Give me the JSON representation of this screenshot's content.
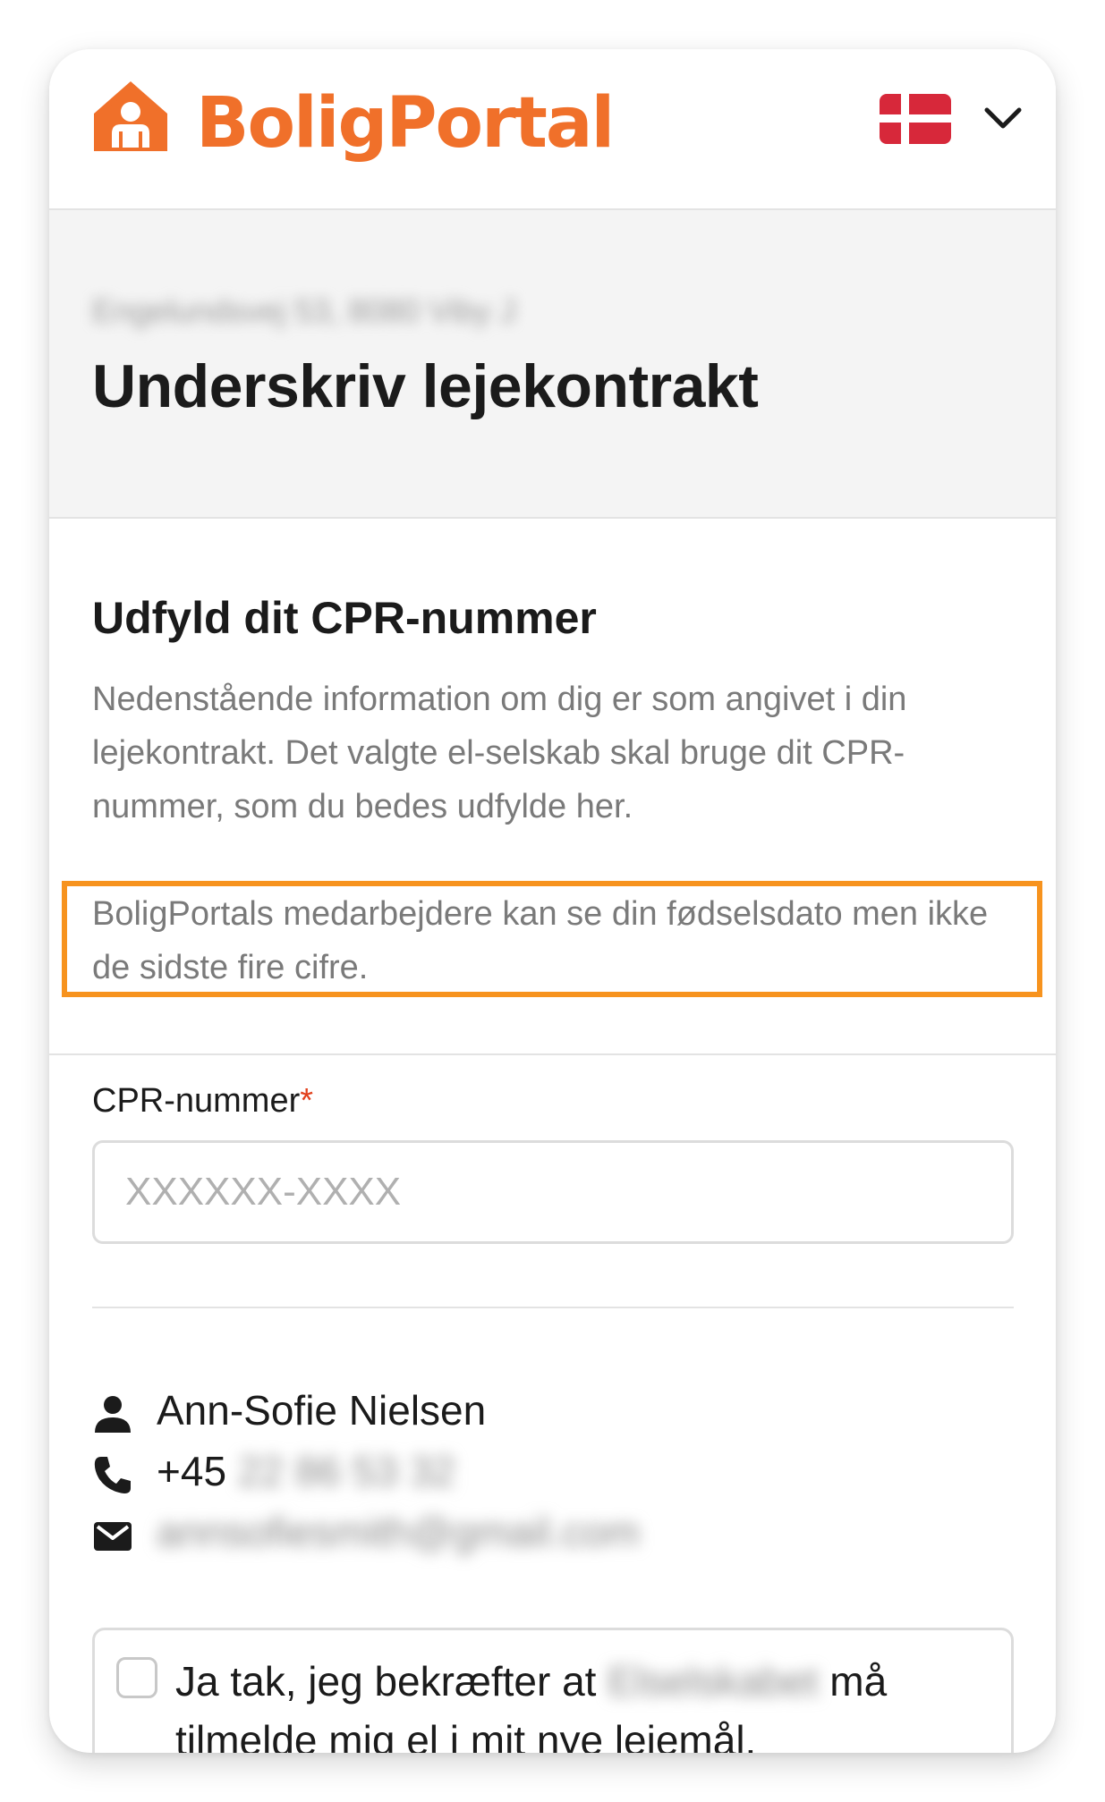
{
  "header": {
    "logo_text": "BoligPortal",
    "language_flag": "denmark-flag",
    "language_chevron": "chevron-down-icon"
  },
  "title_band": {
    "address_blurred": "Engelundsvej 53, 8080 Viby J",
    "title": "Underskriv lejekontrakt"
  },
  "info": {
    "heading": "Udfyld dit CPR-nummer",
    "description": "Nedenstående information om dig er som angivet i din lejekontrakt. Det valgte el-selskab skal bruge dit CPR-nummer, som du bedes udfylde her.",
    "highlight_note": "BoligPortals medarbejdere kan se din fødselsdato men ikke de sidste fire cifre."
  },
  "form": {
    "cpr_label": "CPR-nummer",
    "required_mark": "*",
    "cpr_placeholder": "XXXXXX-XXXX",
    "cpr_value": ""
  },
  "contact": {
    "name": "Ann-Sofie Nielsen",
    "phone_prefix": "+45",
    "phone_blurred": "22 86 53 32",
    "email_blurred": "annsofiesmith@gmail.com"
  },
  "consent": {
    "text_before": "Ja tak, jeg bekræfter at",
    "company_blurred": "Elselskabet",
    "text_after": "må tilmelde mig el i mit nye lejemål.",
    "checked": false
  },
  "colors": {
    "brand_orange": "#f0702a",
    "highlight_border": "#f7931e",
    "required_red": "#e2401c",
    "flag_red": "#d7283a"
  }
}
